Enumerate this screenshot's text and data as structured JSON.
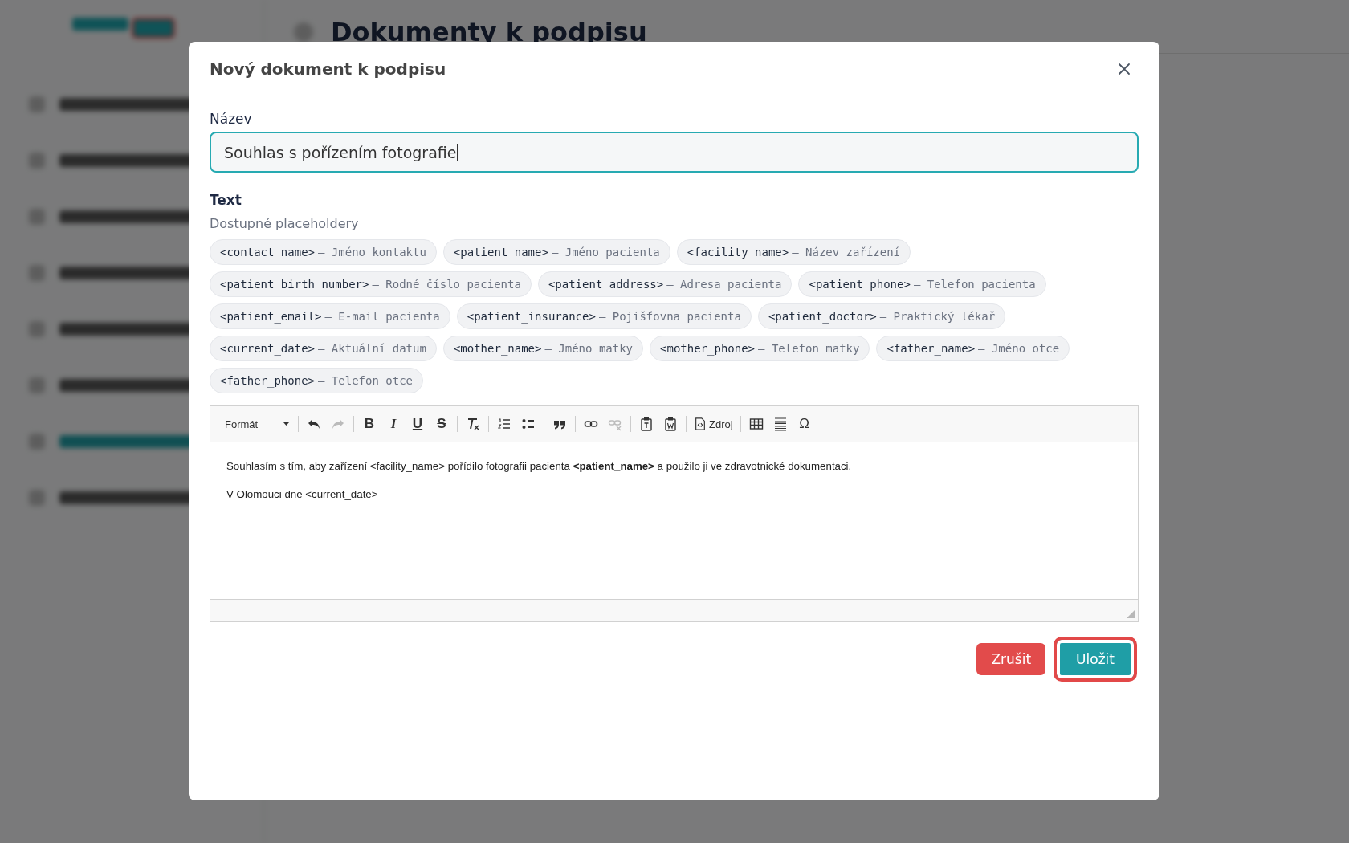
{
  "background": {
    "page_title": "Dokumenty k podpisu"
  },
  "dialog": {
    "title": "Nový dokument k podpisu",
    "name_field": {
      "label": "Název",
      "value": "Souhlas s pořízením fotografie",
      "focused": true
    },
    "text_label": "Text",
    "placeholders_heading": "Dostupné placeholdery",
    "placeholders": [
      {
        "key": "<contact_name>",
        "desc": "— Jméno kontaktu"
      },
      {
        "key": "<patient_name>",
        "desc": "— Jméno pacienta"
      },
      {
        "key": "<facility_name>",
        "desc": "— Název zařízení"
      },
      {
        "key": "<patient_birth_number>",
        "desc": "— Rodné číslo pacienta"
      },
      {
        "key": "<patient_address>",
        "desc": "— Adresa pacienta"
      },
      {
        "key": "<patient_phone>",
        "desc": "— Telefon pacienta"
      },
      {
        "key": "<patient_email>",
        "desc": "— E-mail pacienta"
      },
      {
        "key": "<patient_insurance>",
        "desc": "— Pojišťovna pacienta"
      },
      {
        "key": "<patient_doctor>",
        "desc": "— Praktický lékař"
      },
      {
        "key": "<current_date>",
        "desc": "— Aktuální datum"
      },
      {
        "key": "<mother_name>",
        "desc": "— Jméno matky"
      },
      {
        "key": "<mother_phone>",
        "desc": "— Telefon matky"
      },
      {
        "key": "<father_name>",
        "desc": "— Jméno otce"
      },
      {
        "key": "<father_phone>",
        "desc": "— Telefon otce"
      }
    ],
    "toolbar": [
      [
        {
          "kind": "format",
          "label": "Formát",
          "disabled": false
        }
      ],
      [
        {
          "kind": "undo",
          "disabled": false
        },
        {
          "kind": "redo",
          "disabled": true
        }
      ],
      [
        {
          "kind": "bold",
          "glyph": "B",
          "disabled": false
        },
        {
          "kind": "italic",
          "glyph": "I",
          "disabled": false
        },
        {
          "kind": "underline",
          "glyph": "U",
          "disabled": false
        },
        {
          "kind": "strike",
          "glyph": "S",
          "disabled": false
        }
      ],
      [
        {
          "kind": "clear",
          "disabled": false
        }
      ],
      [
        {
          "kind": "ol",
          "disabled": false
        },
        {
          "kind": "ul",
          "disabled": false
        }
      ],
      [
        {
          "kind": "quote",
          "disabled": false
        }
      ],
      [
        {
          "kind": "link",
          "disabled": false
        },
        {
          "kind": "unlink",
          "disabled": true
        }
      ],
      [
        {
          "kind": "paste-text",
          "disabled": false
        },
        {
          "kind": "paste-word",
          "disabled": false
        }
      ],
      [
        {
          "kind": "source",
          "label": "Zdroj",
          "disabled": false
        }
      ],
      [
        {
          "kind": "table",
          "disabled": false
        },
        {
          "kind": "hr",
          "disabled": false
        },
        {
          "kind": "special-char",
          "glyph": "Ω",
          "disabled": false
        }
      ]
    ],
    "editor_paragraphs": [
      "Souhlasím s tím, aby zařízení <facility_name> pořídilo fotografii pacienta **<patient_name>** a použilo ji ve zdravotnické dokumentaci.",
      "V Olomouci dne <current_date>"
    ],
    "buttons": [
      {
        "label": "Zrušit",
        "kind": "danger",
        "highlighted": false
      },
      {
        "label": "Uložit",
        "kind": "primary",
        "highlighted": true
      }
    ]
  }
}
